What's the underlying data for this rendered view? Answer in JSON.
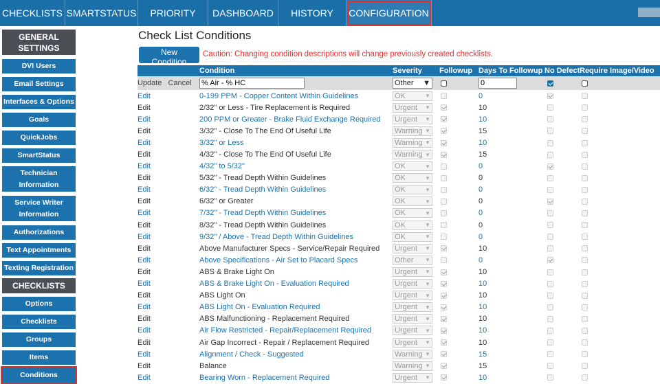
{
  "topnav": {
    "tabs": [
      {
        "label": "CHECKLISTS",
        "active": false
      },
      {
        "label": "SMARTSTATUS",
        "active": false
      },
      {
        "label": "PRIORITY",
        "active": false
      },
      {
        "label": "DASHBOARD",
        "active": false
      },
      {
        "label": "HISTORY",
        "active": false
      },
      {
        "label": "CONFIGURATION",
        "active": true
      }
    ]
  },
  "sidebar": {
    "sections": [
      {
        "type": "header",
        "label": "GENERAL SETTINGS"
      },
      {
        "type": "item",
        "label": "DVI Users"
      },
      {
        "type": "item",
        "label": "Email Settings"
      },
      {
        "type": "item",
        "label": "Interfaces & Options"
      },
      {
        "type": "item",
        "label": "Goals"
      },
      {
        "type": "item",
        "label": "QuickJobs"
      },
      {
        "type": "item",
        "label": "SmartStatus"
      },
      {
        "type": "item",
        "label": "Technician Information"
      },
      {
        "type": "item",
        "label": "Service Writer Information"
      },
      {
        "type": "item",
        "label": "Authorizations"
      },
      {
        "type": "item",
        "label": "Text Appointments"
      },
      {
        "type": "item",
        "label": "Texting Registration"
      },
      {
        "type": "header",
        "label": "CHECKLISTS"
      },
      {
        "type": "item",
        "label": "Options"
      },
      {
        "type": "item",
        "label": "Checklists"
      },
      {
        "type": "item",
        "label": "Groups"
      },
      {
        "type": "item",
        "label": "Items"
      },
      {
        "type": "item",
        "label": "Conditions",
        "active": true
      }
    ]
  },
  "main": {
    "title": "Check List Conditions",
    "new_button": "New Condition",
    "caution": "Caution: Changing condition descriptions will change previously created checklists.",
    "columns": [
      "",
      "Condition",
      "Severity",
      "Followup",
      "Days To Followup",
      "No Defect",
      "Require Image/Video"
    ],
    "edit_row": {
      "update_label": "Update",
      "cancel_label": "Cancel",
      "condition_value": "% Air - % HC",
      "severity_value": "Other",
      "followup": false,
      "days_value": "0",
      "no_defect": true,
      "require_image": false
    },
    "rows": [
      {
        "edit": "Edit",
        "condition": "0-199 PPM - Copper Content Within Guidelines",
        "severity": "OK",
        "followup": false,
        "days": "0",
        "no_defect": true,
        "require_image": false
      },
      {
        "edit": "Edit",
        "condition": "2/32\" or Less - Tire Replacement is Required",
        "severity": "Urgent",
        "followup": true,
        "days": "10",
        "no_defect": false,
        "require_image": false
      },
      {
        "edit": "Edit",
        "condition": "200 PPM or Greater - Brake Fluid Exchange Required",
        "severity": "Urgent",
        "followup": true,
        "days": "10",
        "no_defect": false,
        "require_image": false
      },
      {
        "edit": "Edit",
        "condition": "3/32\" - Close To The End Of Useful Life",
        "severity": "Warning",
        "followup": true,
        "days": "15",
        "no_defect": false,
        "require_image": false
      },
      {
        "edit": "Edit",
        "condition": "3/32\" or Less",
        "severity": "Warning",
        "followup": true,
        "days": "10",
        "no_defect": false,
        "require_image": false
      },
      {
        "edit": "Edit",
        "condition": "4/32\" - Close To The End Of Useful Life",
        "severity": "Warning",
        "followup": true,
        "days": "15",
        "no_defect": false,
        "require_image": false
      },
      {
        "edit": "Edit",
        "condition": "4/32\" to 5/32\"",
        "severity": "OK",
        "followup": false,
        "days": "0",
        "no_defect": true,
        "require_image": false
      },
      {
        "edit": "Edit",
        "condition": "5/32\" - Tread Depth Within Guidelines",
        "severity": "OK",
        "followup": false,
        "days": "0",
        "no_defect": false,
        "require_image": false
      },
      {
        "edit": "Edit",
        "condition": "6/32\" - Tread Depth Within Guidelines",
        "severity": "OK",
        "followup": false,
        "days": "0",
        "no_defect": false,
        "require_image": false
      },
      {
        "edit": "Edit",
        "condition": "6/32\" or Greater",
        "severity": "OK",
        "followup": false,
        "days": "0",
        "no_defect": true,
        "require_image": false
      },
      {
        "edit": "Edit",
        "condition": "7/32\" - Tread Depth Within Guidelines",
        "severity": "OK",
        "followup": false,
        "days": "0",
        "no_defect": false,
        "require_image": false
      },
      {
        "edit": "Edit",
        "condition": "8/32\" - Tread Depth Within Guidelines",
        "severity": "OK",
        "followup": false,
        "days": "0",
        "no_defect": false,
        "require_image": false
      },
      {
        "edit": "Edit",
        "condition": "9/32\" / Above - Tread Depth Within Guidelines",
        "severity": "OK",
        "followup": false,
        "days": "0",
        "no_defect": false,
        "require_image": false
      },
      {
        "edit": "Edit",
        "condition": "Above Manufacturer Specs - Service/Repair Required",
        "severity": "Urgent",
        "followup": true,
        "days": "10",
        "no_defect": false,
        "require_image": false
      },
      {
        "edit": "Edit",
        "condition": "Above Specifications - Air Set to Placard Specs",
        "severity": "Other",
        "followup": false,
        "days": "0",
        "no_defect": true,
        "require_image": false
      },
      {
        "edit": "Edit",
        "condition": "ABS & Brake Light On",
        "severity": "Urgent",
        "followup": true,
        "days": "10",
        "no_defect": false,
        "require_image": false
      },
      {
        "edit": "Edit",
        "condition": "ABS & Brake Light On - Evaluation Required",
        "severity": "Urgent",
        "followup": true,
        "days": "10",
        "no_defect": false,
        "require_image": false
      },
      {
        "edit": "Edit",
        "condition": "ABS Light On",
        "severity": "Urgent",
        "followup": true,
        "days": "10",
        "no_defect": false,
        "require_image": false
      },
      {
        "edit": "Edit",
        "condition": "ABS Light On - Evaluation Required",
        "severity": "Urgent",
        "followup": true,
        "days": "10",
        "no_defect": false,
        "require_image": false
      },
      {
        "edit": "Edit",
        "condition": "ABS Malfunctioning - Replacement Required",
        "severity": "Urgent",
        "followup": true,
        "days": "10",
        "no_defect": false,
        "require_image": false
      },
      {
        "edit": "Edit",
        "condition": "Air Flow Restricted - Repair/Replacement Required",
        "severity": "Urgent",
        "followup": true,
        "days": "10",
        "no_defect": false,
        "require_image": false
      },
      {
        "edit": "Edit",
        "condition": "Air Gap Incorrect - Repair / Replacement Required",
        "severity": "Urgent",
        "followup": true,
        "days": "10",
        "no_defect": false,
        "require_image": false
      },
      {
        "edit": "Edit",
        "condition": "Alignment / Check - Suggested",
        "severity": "Warning",
        "followup": true,
        "days": "15",
        "no_defect": false,
        "require_image": false
      },
      {
        "edit": "Edit",
        "condition": "Balance",
        "severity": "Warning",
        "followup": true,
        "days": "15",
        "no_defect": false,
        "require_image": false
      },
      {
        "edit": "Edit",
        "condition": "Bearing Worn - Replacement Required",
        "severity": "Urgent",
        "followup": true,
        "days": "10",
        "no_defect": false,
        "require_image": false
      }
    ]
  }
}
